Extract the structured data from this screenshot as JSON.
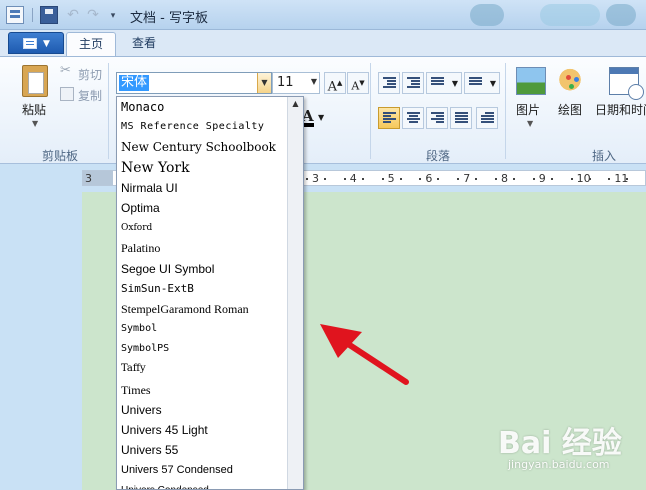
{
  "window": {
    "title": "文档 - 写字板"
  },
  "tabs": [
    {
      "label": "主页",
      "active": true
    },
    {
      "label": "查看",
      "active": false
    }
  ],
  "clipboard": {
    "paste_label": "粘贴",
    "cut_label": "剪切",
    "copy_label": "复制",
    "group_label": "剪贴板"
  },
  "font": {
    "family_value": "宋体",
    "size_value": "11"
  },
  "paragraph": {
    "group_label": "段落"
  },
  "insert": {
    "picture_label": "图片",
    "paint_label": "绘图",
    "datetime_label": "日期和时间",
    "group_label": "插入"
  },
  "ruler": {
    "left_label": "3",
    "marks": [
      "3",
      "4",
      "5",
      "6",
      "7",
      "8",
      "9",
      "10",
      "11"
    ]
  },
  "font_list": [
    {
      "name": "Monaco",
      "family": "\"DejaVu Sans Mono\", monospace",
      "size": 12,
      "spacing": 0
    },
    {
      "name": "MS Reference Specialty",
      "family": "\"DejaVu Sans Mono\", monospace",
      "size": 10,
      "spacing": 0.5
    },
    {
      "name": "New Century Schoolbook",
      "family": "\"DejaVu Serif\", serif",
      "size": 12,
      "spacing": 0
    },
    {
      "name": "New York",
      "family": "\"DejaVu Serif\", serif",
      "size": 14,
      "spacing": 0
    },
    {
      "name": "Nirmala UI",
      "family": "\"Liberation Sans\", sans-serif",
      "size": 12,
      "spacing": 0
    },
    {
      "name": "Optima",
      "family": "\"Liberation Sans\", sans-serif",
      "size": 12,
      "spacing": 0
    },
    {
      "name": "Oxford",
      "family": "\"DejaVu Serif\", serif",
      "size": 9,
      "spacing": 0
    },
    {
      "name": "Palatino",
      "family": "\"Liberation Serif\", serif",
      "size": 12,
      "spacing": 0
    },
    {
      "name": "Segoe UI Symbol",
      "family": "\"Liberation Sans\", sans-serif",
      "size": 12,
      "spacing": 0
    },
    {
      "name": "SimSun-ExtB",
      "family": "\"DejaVu Sans Mono\", monospace",
      "size": 11,
      "spacing": 0
    },
    {
      "name": "StempelGaramond Roman",
      "family": "\"Liberation Serif\", serif",
      "size": 12,
      "spacing": 0
    },
    {
      "name": "Symbol",
      "family": "\"DejaVu Sans Mono\", monospace",
      "size": 10,
      "spacing": 0
    },
    {
      "name": "SymbolPS",
      "family": "\"DejaVu Sans Mono\", monospace",
      "size": 10,
      "spacing": 0
    },
    {
      "name": "Taffy",
      "family": "\"DejaVu Serif\", serif",
      "size": 10,
      "spacing": 0
    },
    {
      "name": "Times",
      "family": "\"Liberation Serif\", serif",
      "size": 12,
      "spacing": 0
    },
    {
      "name": "Univers",
      "family": "\"Liberation Sans\", sans-serif",
      "size": 12,
      "spacing": 0
    },
    {
      "name": "Univers 45 Light",
      "family": "\"Liberation Sans\", sans-serif",
      "size": 12,
      "spacing": 0
    },
    {
      "name": "Univers 55",
      "family": "\"Liberation Sans\", sans-serif",
      "size": 12,
      "spacing": 0
    },
    {
      "name": "Univers 57 Condensed",
      "family": "\"Liberation Sans\", sans-serif",
      "size": 11,
      "spacing": 0
    },
    {
      "name": "Univers Condensed",
      "family": "\"Liberation Sans\", sans-serif",
      "size": 10,
      "spacing": 0
    }
  ],
  "watermark": {
    "text": "Bai 经验",
    "sub": "jingyan.baidu.com"
  },
  "colors": {
    "selection": "#3399ff",
    "document_bg": "#cce5cc",
    "arrow": "#e0141e"
  }
}
